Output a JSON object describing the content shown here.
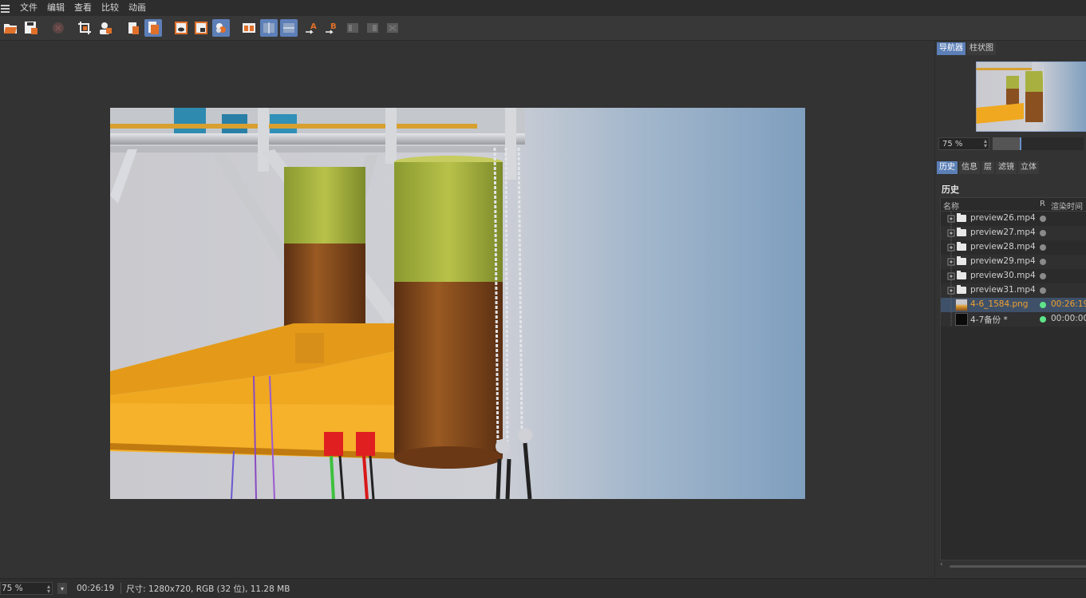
{
  "menu": {
    "items": [
      "文件",
      "编辑",
      "查看",
      "比较",
      "动画"
    ]
  },
  "toolbar": {
    "buttons": [
      {
        "name": "open-image-icon",
        "active": false
      },
      {
        "name": "save-image-icon",
        "active": false
      },
      {
        "name": "stop-render-icon",
        "active": false
      },
      {
        "name": "crop-icon",
        "active": false
      },
      {
        "name": "user-render-icon",
        "active": false
      },
      {
        "name": "copy-to-clipboard-icon",
        "active": false
      },
      {
        "name": "multi-pass-icon",
        "active": true
      },
      {
        "name": "view-a-icon",
        "active": false
      },
      {
        "name": "view-b-icon",
        "active": false
      },
      {
        "name": "color-channels-icon",
        "active": false
      },
      {
        "name": "ab-compare-icon",
        "active": false
      },
      {
        "name": "split-horizontal-icon",
        "active": true
      },
      {
        "name": "split-vertical-icon",
        "active": true
      },
      {
        "name": "set-a-icon",
        "active": false
      },
      {
        "name": "set-b-icon",
        "active": false
      },
      {
        "name": "swap-ab-icon",
        "active": false
      },
      {
        "name": "difference-icon",
        "active": false
      },
      {
        "name": "fit-icon",
        "active": false
      }
    ]
  },
  "navigator": {
    "tabs": [
      {
        "label": "导航器",
        "active": true
      },
      {
        "label": "柱状图",
        "active": false
      }
    ],
    "zoom_value": "75 %",
    "zoom_level": 0.3
  },
  "history": {
    "tabs": [
      {
        "label": "历史",
        "active": true
      },
      {
        "label": "信息",
        "active": false
      },
      {
        "label": "层",
        "active": false
      },
      {
        "label": "滤镜",
        "active": false
      },
      {
        "label": "立体",
        "active": false
      }
    ],
    "title": "历史",
    "columns": {
      "name": "名称",
      "r": "R",
      "render_time": "渲染时间"
    },
    "rows": [
      {
        "name": "preview26.mp4",
        "type": "folder",
        "status": "#8a8a8a",
        "time": ""
      },
      {
        "name": "preview27.mp4",
        "type": "folder",
        "status": "#8a8a8a",
        "time": ""
      },
      {
        "name": "preview28.mp4",
        "type": "folder",
        "status": "#8a8a8a",
        "time": ""
      },
      {
        "name": "preview29.mp4",
        "type": "folder",
        "status": "#8a8a8a",
        "time": ""
      },
      {
        "name": "preview30.mp4",
        "type": "folder",
        "status": "#8a8a8a",
        "time": ""
      },
      {
        "name": "preview31.mp4",
        "type": "folder",
        "status": "#8a8a8a",
        "time": ""
      },
      {
        "name": "4-6_1584.png",
        "type": "image",
        "status": "#5fe38a",
        "time": "00:26:19",
        "selected": true,
        "color": "#f0a030"
      },
      {
        "name": "4-7备份 *",
        "type": "dark-image",
        "status": "#5fe38a",
        "time": "00:00:00"
      }
    ]
  },
  "statusbar": {
    "zoom": "75 %",
    "time": "00:26:19",
    "info": "尺寸: 1280x720, RGB (32 位), 11.28 MB"
  }
}
